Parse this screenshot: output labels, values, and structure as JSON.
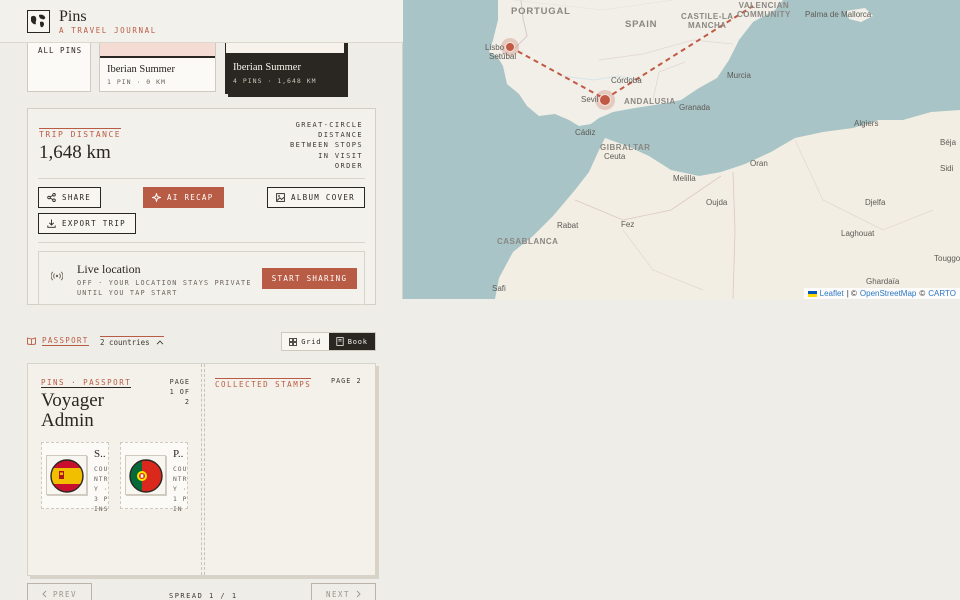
{
  "header": {
    "title": "Pins",
    "subtitle": "A TRAVEL JOURNAL"
  },
  "trips": {
    "all_label": "ALL PINS",
    "items": [
      {
        "name": "Iberian Summer",
        "meta": "1 PIN · 0 KM"
      },
      {
        "name": "Iberian Summer",
        "meta": "4 PINS · 1,648 KM"
      }
    ]
  },
  "distance": {
    "label": "TRIP DISTANCE",
    "value": "1,648 km",
    "description": "GREAT-CIRCLE DISTANCE BETWEEN STOPS IN VISIT ORDER"
  },
  "actions": {
    "share": "SHARE",
    "ai_recap": "AI RECAP",
    "album_cover": "ALBUM COVER",
    "export_trip": "EXPORT TRIP"
  },
  "live_location": {
    "title": "Live location",
    "description": "OFF · YOUR LOCATION STAYS PRIVATE UNTIL YOU TAP START",
    "button": "START SHARING"
  },
  "passport": {
    "tab_label": "PASSPORT",
    "countries_count": "2 countries",
    "view_options": {
      "grid": "Grid",
      "book": "Book"
    },
    "active_view": "Book",
    "page1_label": "PINS · PASSPORT",
    "page1_number": "PAGE 1 OF 2",
    "owner": "Voyager Admin",
    "stamps": [
      {
        "name": "S..",
        "info": "COUNTRY · 3 PINS",
        "flag": "spain"
      },
      {
        "name": "P..",
        "info": "COUNTRY · 1 PIN",
        "flag": "portugal"
      }
    ],
    "page2_label": "COLLECTED STAMPS",
    "page2_number": "PAGE 2",
    "prev": "PREV",
    "next": "NEXT",
    "spread": "SPREAD 1 / 1"
  },
  "map": {
    "labels": {
      "portugal": "PORTUGAL",
      "spain": "SPAIN",
      "castile": "CASTILE-LA\nMANCHA",
      "valencian": "VALENCIAN\nCOMMUNITY",
      "andalusia": "ANDALUSIA",
      "gibraltar": "GIBRALTAR",
      "casablanca": "CASABLANCA",
      "lisboa": "Lisbo",
      "setubal": "Setúbal",
      "cordoba": "Córdoba",
      "sevilla": "Sevil",
      "granada": "Granada",
      "murcia": "Murcia",
      "palma": "Palma de Mallorca",
      "cadiz": "Cádiz",
      "ceuta": "Ceuta",
      "algiers": "Algiers",
      "oran": "Oran",
      "melilla": "Melilla",
      "oujda": "Oujda",
      "rabat": "Rabat",
      "fez": "Fez",
      "djelfa": "Djelfa",
      "laghouat": "Laghouat",
      "ghardaia": "Ghardaïa",
      "touggourt": "Touggo",
      "safi": "Safi",
      "bejaia": "Béja",
      "sidi": "Sidi"
    },
    "attribution": {
      "leaflet": "Leaflet",
      "sep": "| ©",
      "osm": "OpenStreetMap",
      "copy": "©",
      "carto": "CARTO"
    }
  },
  "colors": {
    "accent": "#b95c45",
    "ink": "#2a2622",
    "paper": "#efede8"
  }
}
